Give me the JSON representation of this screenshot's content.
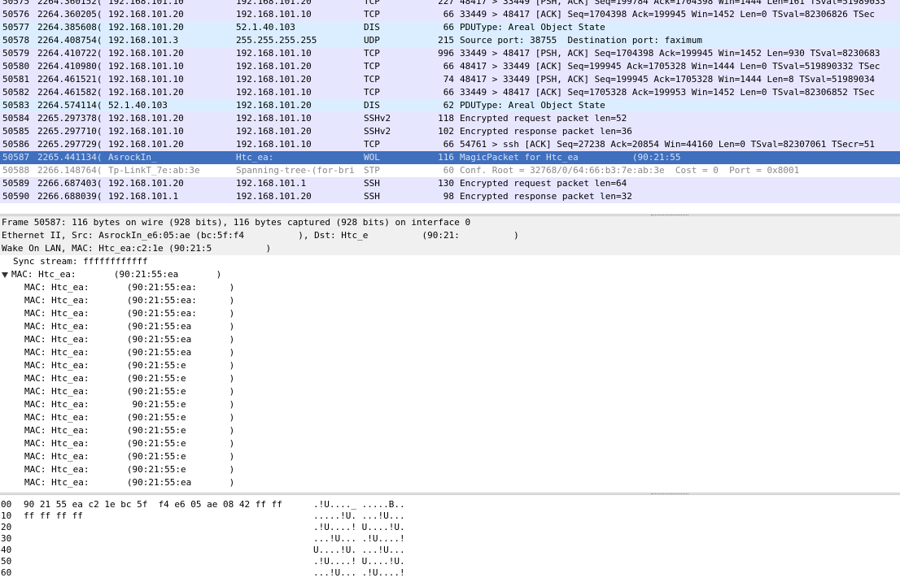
{
  "packets": [
    {
      "no": "50575",
      "time": "2264.360152(",
      "src": "192.168.101.10",
      "dst": "192.168.101.20",
      "proto": "TCP",
      "len": "227",
      "info": "48417 > 33449 [PSH, ACK] Seq=199784 Ack=1704398 Win=1444 Len=161 TSval=51989033",
      "cls": "tcp"
    },
    {
      "no": "50576",
      "time": "2264.360205(",
      "src": "192.168.101.20",
      "dst": "192.168.101.10",
      "proto": "TCP",
      "len": "66",
      "info": "33449 > 48417 [ACK] Seq=1704398 Ack=199945 Win=1452 Len=0 TSval=82306826 TSec",
      "cls": "tcp"
    },
    {
      "no": "50577",
      "time": "2264.385608(",
      "src": "192.168.101.20",
      "dst": "52.1.40.103",
      "proto": "DIS",
      "len": "66",
      "info": "PDUType: Areal Object State",
      "cls": "dis"
    },
    {
      "no": "50578",
      "time": "2264.408754(",
      "src": "192.168.101.3",
      "dst": "255.255.255.255",
      "proto": "UDP",
      "len": "215",
      "info": "Source port: 38755  Destination port: faximum",
      "cls": "udp"
    },
    {
      "no": "50579",
      "time": "2264.410722(",
      "src": "192.168.101.20",
      "dst": "192.168.101.10",
      "proto": "TCP",
      "len": "996",
      "info": "33449 > 48417 [PSH, ACK] Seq=1704398 Ack=199945 Win=1452 Len=930 TSval=8230683",
      "cls": "tcp"
    },
    {
      "no": "50580",
      "time": "2264.410980(",
      "src": "192.168.101.10",
      "dst": "192.168.101.20",
      "proto": "TCP",
      "len": "66",
      "info": "48417 > 33449 [ACK] Seq=199945 Ack=1705328 Win=1444 Len=0 TSval=519890332 TSec",
      "cls": "tcp"
    },
    {
      "no": "50581",
      "time": "2264.461521(",
      "src": "192.168.101.10",
      "dst": "192.168.101.20",
      "proto": "TCP",
      "len": "74",
      "info": "48417 > 33449 [PSH, ACK] Seq=199945 Ack=1705328 Win=1444 Len=8 TSval=51989034",
      "cls": "tcp"
    },
    {
      "no": "50582",
      "time": "2264.461582(",
      "src": "192.168.101.20",
      "dst": "192.168.101.10",
      "proto": "TCP",
      "len": "66",
      "info": "33449 > 48417 [ACK] Seq=1705328 Ack=199953 Win=1452 Len=0 TSval=82306852 TSec",
      "cls": "tcp"
    },
    {
      "no": "50583",
      "time": "2264.574114(",
      "src": "52.1.40.103",
      "dst": "192.168.101.20",
      "proto": "DIS",
      "len": "62",
      "info": "PDUType: Areal Object State",
      "cls": "dis"
    },
    {
      "no": "50584",
      "time": "2265.297378(",
      "src": "192.168.101.20",
      "dst": "192.168.101.10",
      "proto": "SSHv2",
      "len": "118",
      "info": "Encrypted request packet len=52",
      "cls": "ssh"
    },
    {
      "no": "50585",
      "time": "2265.297710(",
      "src": "192.168.101.10",
      "dst": "192.168.101.20",
      "proto": "SSHv2",
      "len": "102",
      "info": "Encrypted response packet len=36",
      "cls": "ssh"
    },
    {
      "no": "50586",
      "time": "2265.297729(",
      "src": "192.168.101.20",
      "dst": "192.168.101.10",
      "proto": "TCP",
      "len": "66",
      "info": "54761 > ssh [ACK] Seq=27238 Ack=20854 Win=44160 Len=0 TSval=82307061 TSecr=51",
      "cls": "tcp"
    },
    {
      "no": "50587",
      "time": "2265.441134(",
      "src": "AsrockIn_",
      "dst": "Htc_ea:",
      "proto": "WOL",
      "len": "116",
      "info": "MagicPacket for Htc_ea          (90:21:55",
      "cls": "sel"
    },
    {
      "no": "50588",
      "time": "2266.148764(",
      "src": "Tp-LinkT_7e:ab:3e",
      "dst": "Spanning-tree-(for-bri",
      "proto": "STP",
      "len": "60",
      "info": "Conf. Root = 32768/0/64:66:b3:7e:ab:3e  Cost = 0  Port = 0x8001",
      "cls": "stp"
    },
    {
      "no": "50589",
      "time": "2266.687403(",
      "src": "192.168.101.20",
      "dst": "192.168.101.1",
      "proto": "SSH",
      "len": "130",
      "info": "Encrypted request packet len=64",
      "cls": "ssh"
    },
    {
      "no": "50590",
      "time": "2266.688039(",
      "src": "192.168.101.1",
      "dst": "192.168.101.20",
      "proto": "SSH",
      "len": "98",
      "info": "Encrypted response packet len=32",
      "cls": "ssh"
    }
  ],
  "details": {
    "frame": "Frame 50587: 116 bytes on wire (928 bits), 116 bytes captured (928 bits) on interface 0",
    "ethernet": "Ethernet II, Src: AsrockIn_e6:05:ae (bc:5f:f4          ), Dst: Htc_e          (90:21:          )",
    "wol": "Wake On LAN, MAC: Htc_ea:c2:1e (90:21:5          )",
    "sync": "Sync stream: ffffffffffff",
    "mac_header": "MAC: Htc_ea:       (90:21:55:ea       )",
    "macs": [
      "MAC: Htc_ea:       (90:21:55:ea:      )",
      "MAC: Htc_ea:       (90:21:55:ea:      )",
      "MAC: Htc_ea:       (90:21:55:ea:      )",
      "MAC: Htc_ea:       (90:21:55:ea       )",
      "MAC: Htc_ea:       (90:21:55:ea       )",
      "MAC: Htc_ea:       (90:21:55:ea       )",
      "MAC: Htc_ea:       (90:21:55:e        )",
      "MAC: Htc_ea:       (90:21:55:e        )",
      "MAC: Htc_ea:       (90:21:55:e        )",
      "MAC: Htc_ea:        90:21:55:e        )",
      "MAC: Htc_ea:       (90:21:55:e        )",
      "MAC: Htc_ea:       (90:21:55:e        )",
      "MAC: Htc_ea:       (90:21:55:e        )",
      "MAC: Htc_ea:       (90:21:55:e        )",
      "MAC: Htc_ea:       (90:21:55:e        )",
      "MAC: Htc_ea:       (90:21:55:ea       )"
    ]
  },
  "hex": [
    {
      "off": "00",
      "hex": "90 21 55 ea c2 1e bc 5f  f4 e6 05 ae 08 42 ff ff",
      "asc": ".!U...._ .....B.."
    },
    {
      "off": "10",
      "hex": "ff ff ff ff",
      "asc": ".....!U. ...!U..."
    },
    {
      "off": "20",
      "hex": "",
      "asc": ".!U....! U....!U."
    },
    {
      "off": "30",
      "hex": "",
      "asc": "...!U... .!U....!"
    },
    {
      "off": "40",
      "hex": "",
      "asc": "U....!U. ...!U..."
    },
    {
      "off": "50",
      "hex": "",
      "asc": ".!U....! U....!U."
    },
    {
      "off": "60",
      "hex": "",
      "asc": "...!U... .!U....!"
    }
  ],
  "colors": {
    "selected": "#3f6fbd",
    "tcp": "#e7e6ff",
    "dis": "#daeeff",
    "detail_bg": "#f0f0f0"
  }
}
